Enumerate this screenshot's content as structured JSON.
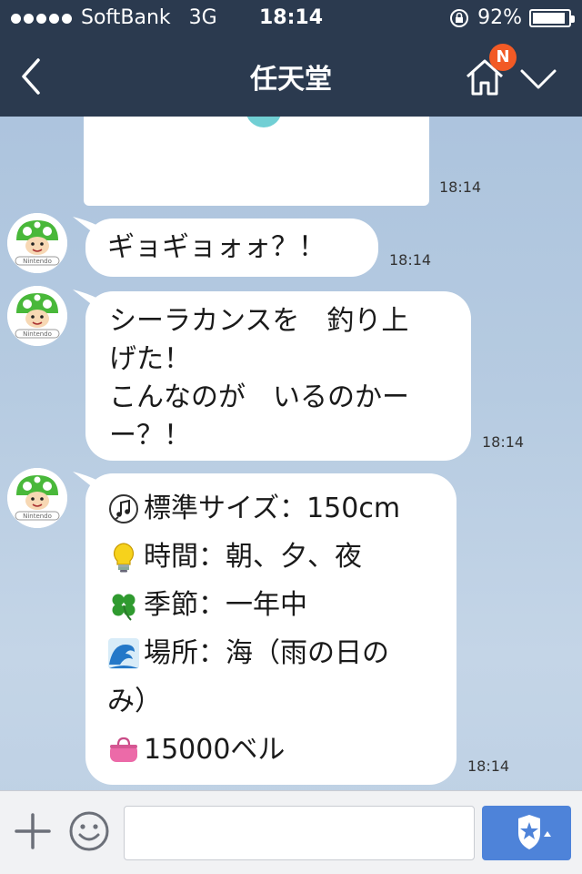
{
  "status_bar": {
    "carrier": "SoftBank",
    "network": "3G",
    "time": "18:14",
    "battery": "92%",
    "battery_level": 0.92
  },
  "header": {
    "title": "任天堂",
    "badge": "N"
  },
  "messages": [
    {
      "time": "18:14"
    },
    {
      "text": "ギョギョォォ？！",
      "time": "18:14",
      "sender_logo": "Nintendo"
    },
    {
      "lines": [
        "シーラカンスを　釣り上",
        "げた！",
        "こんなのが　いるのかー",
        "ー？！"
      ],
      "time": "18:14",
      "sender_logo": "Nintendo"
    },
    {
      "lines": [
        {
          "icon": "music-note-icon",
          "text": "標準サイズ：150cm"
        },
        {
          "icon": "lightbulb-icon",
          "text": "時間：朝、夕、夜"
        },
        {
          "icon": "clover-icon",
          "text": "季節：一年中"
        },
        {
          "icon": "wave-icon",
          "text": "場所：海（雨の日の"
        },
        {
          "icon": "",
          "text": "み）"
        },
        {
          "icon": "purse-icon",
          "text": "15000ベル"
        }
      ],
      "time": "18:14",
      "sender_logo": "Nintendo"
    }
  ],
  "input": {
    "placeholder": "",
    "value": ""
  },
  "colors": {
    "header_bg": "#2b3a4f",
    "badge": "#f25a25",
    "send_button": "#4e83d9",
    "avatar_green": "#49b83a"
  }
}
